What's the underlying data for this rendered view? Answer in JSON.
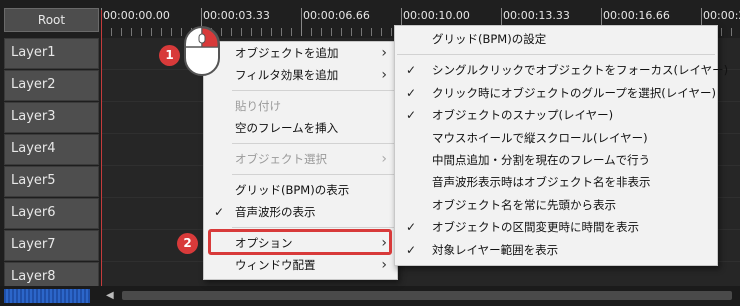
{
  "header": {
    "root_label": "Root"
  },
  "ruler": {
    "times": [
      "00:00:00.00",
      "00:00:03.33",
      "00:00:06.66",
      "00:00:10.00",
      "00:00:13.33",
      "00:00:16.66",
      "00:00:2"
    ]
  },
  "layers": [
    "Layer1",
    "Layer2",
    "Layer3",
    "Layer4",
    "Layer5",
    "Layer6",
    "Layer7",
    "Layer8"
  ],
  "context_menu": {
    "add_object": "オブジェクトを追加",
    "add_filter": "フィルタ効果を追加",
    "paste": "貼り付け",
    "insert_empty_frame": "空のフレームを挿入",
    "select_object": "オブジェクト選択",
    "show_grid": "グリッド(BPM)の表示",
    "show_waveform": "音声波形の表示",
    "options": "オプション",
    "window_layout": "ウィンドウ配置"
  },
  "options_menu": {
    "grid_settings": "グリッド(BPM)の設定",
    "single_click_focus": "シングルクリックでオブジェクトをフォーカス(レイヤー)",
    "click_select_group": "クリック時にオブジェクトのグループを選択(レイヤー)",
    "object_snap": "オブジェクトのスナップ(レイヤー)",
    "wheel_vertical_scroll": "マウスホイールで縦スクロール(レイヤー)",
    "midpoint_split_current": "中間点追加・分割を現在のフレームで行う",
    "hide_name_on_waveform": "音声波形表示時はオブジェクト名を非表示",
    "name_from_start": "オブジェクト名を常に先頭から表示",
    "show_time_on_change": "オブジェクトの区間変更時に時間を表示",
    "show_target_layer_range": "対象レイヤー範囲を表示"
  },
  "annotations": {
    "step1": "1",
    "step2": "2"
  },
  "colors": {
    "accent_red": "#d83a3a",
    "menu_bg": "#f2f2f2",
    "layer_bg": "#4e4e4e"
  }
}
